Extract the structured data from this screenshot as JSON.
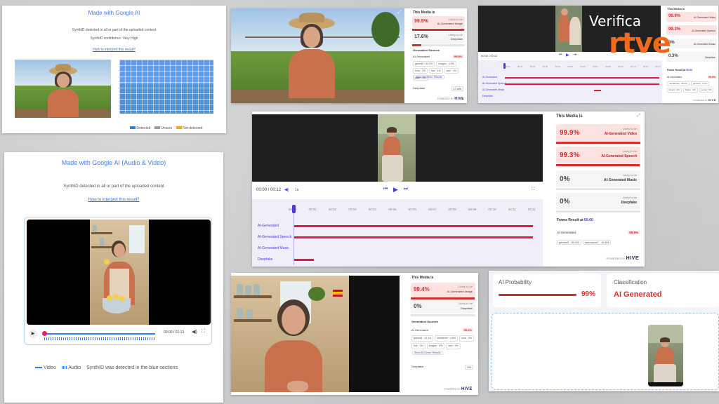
{
  "p1": {
    "title": "Made with Google AI",
    "detected": "SynthID detected in all or part of the uploaded content",
    "confidence": "SynthID confidence: Very High",
    "link": "How to interpret this result?",
    "legend": [
      "Detected",
      "Unsure",
      "Not detected"
    ],
    "colors": {
      "detected": "#2f80ed",
      "unsure": "#9e9e9e",
      "not_detected": "#f5a623"
    }
  },
  "p2": {
    "header": "This Media is",
    "r1_pct": "99.9%",
    "r1_label": "AI-Generated Image",
    "r1_sub": "Likely to be",
    "r2_pct": "17.6%",
    "r2_label": "Deepfake",
    "r2_sub": "Likely to be",
    "sources_title": "Generation Sources",
    "src_main": "AI Generated",
    "src_main_pct": "99.9%",
    "chips": [
      "gemini3 · 62.0%",
      "imagen · 4.9%",
      "sora · 2%",
      "flux · 1%",
      "sdxl · 1%",
      "dalle · 0%"
    ],
    "show_all": "Show All Gener. Results",
    "deepfake": "Deepfake",
    "deepfake_pct": "17.6%",
    "powered": "POWERED BY",
    "logo": "HIVE"
  },
  "p3": {
    "time": "00:00 / 00:12",
    "ticks": [
      "00:00",
      "00:01",
      "00:02",
      "00:03",
      "00:04",
      "00:05",
      "00:06",
      "00:07",
      "00:08",
      "00:09",
      "00:10",
      "00:11",
      "00:12"
    ],
    "tracks": [
      "AI-Generated",
      "AI-Generated Speech",
      "AI-Generated Music",
      "Deepfake"
    ],
    "header": "This Media is",
    "r1_pct": "99.9%",
    "r1_label": "AI-Generated Video",
    "r2_pct": "99.3%",
    "r2_label": "AI-Generated Speech",
    "r3_pct": "0%",
    "r3_label": "AI-Generated Music",
    "r4_pct": "0.3%",
    "r4_label": "Deepfake",
    "frame": "Frame Result at",
    "frame_time": "00:00",
    "frame_main": "AI Generated",
    "frame_pct": "99.9%",
    "chips": [
      "seedance2 · 89.4%",
      "gemini3 · 3.1%",
      "kling3 · 0%",
      "hailuo · 0%",
      "sora2 · 0%"
    ],
    "powered": "POWERED BY",
    "logo": "HIVE",
    "watermark_title": "Verifica",
    "watermark_brand": "rtve"
  },
  "p4": {
    "time": "00:00 / 00:12",
    "speed": "1x",
    "ticks": [
      "00:00",
      "00:01",
      "00:02",
      "00:03",
      "00:04",
      "00:05",
      "00:06",
      "00:07",
      "00:08",
      "00:09",
      "00:10",
      "00:11",
      "00:11"
    ],
    "tracks": [
      "AI-Generated",
      "AI-Generated Speech",
      "AI-Generated Music",
      "Deepfake"
    ],
    "header": "This Media is",
    "sub": "Likely to be",
    "r1_pct": "99.9%",
    "r1_label": "AI-Generated Video",
    "r2_pct": "99.3%",
    "r2_label": "AI-Generated Speech",
    "r3_pct": "0%",
    "r3_label": "AI-Generated Music",
    "r4_pct": "0%",
    "r4_label": "Deepfake",
    "frame": "Frame Result at",
    "frame_time": "00:00",
    "frame_main": "AI Generated",
    "frame_pct": "99.9%",
    "chips": [
      "gemini3 · 80.4%",
      "seedance2 · 16.8%"
    ],
    "powered": "POWERED BY",
    "logo": "HIVE"
  },
  "p5": {
    "title": "Made with Google AI (Audio & Video)",
    "detected": "SynthID detected in all or part of the uploaded content",
    "link": "How to interpret this result?",
    "time": "00:00 / 01:13",
    "legend_video": "Video",
    "legend_audio": "Audio",
    "legend_text": "SynthID was detected in the blue sections"
  },
  "p6": {
    "header": "This Media is",
    "sub": "Likely to be",
    "r1_pct": "99.4%",
    "r1_label": "AI-Generated Image",
    "r2_pct": "0%",
    "r2_label": "Deepfake",
    "sources_title": "Generation Sources",
    "src_main": "AI Generated",
    "src_main_pct": "99.4%",
    "chips": [
      "gemini3 · 92.1%",
      "seedream · 4.5%",
      "sora · 2%",
      "flux · 1%",
      "imagen · 0%",
      "sdxl · 0%"
    ],
    "show_all": "Show All Gener. Results",
    "deepfake": "Deepfake",
    "deepfake_pct": "0%",
    "powered": "POWERED BY",
    "logo": "HIVE"
  },
  "p7": {
    "prob_label": "AI Probability",
    "prob_pct": "99%",
    "prob_value": 0.99,
    "class_label": "Classification",
    "class_value": "AI Generated"
  }
}
